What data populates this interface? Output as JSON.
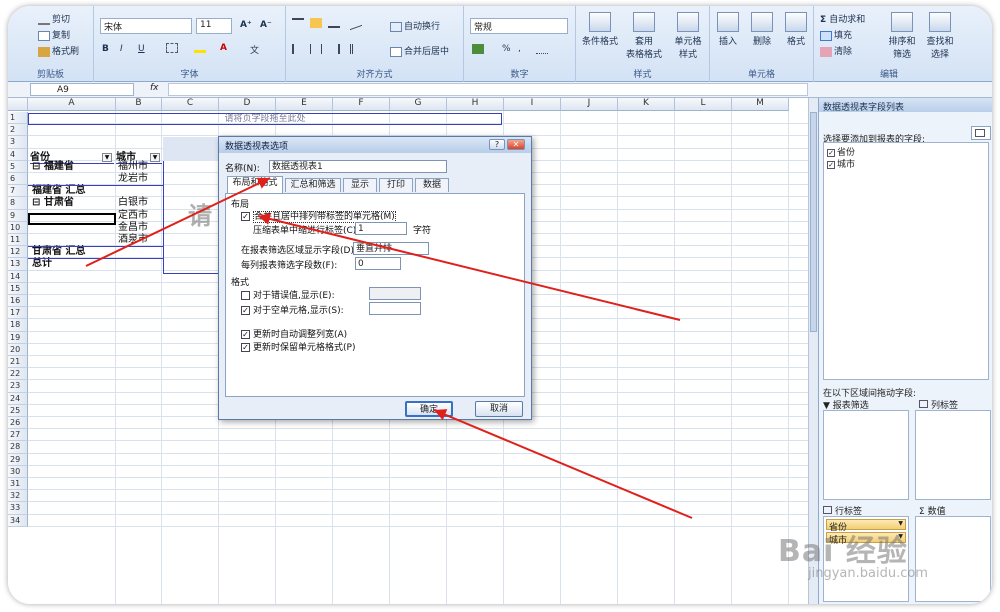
{
  "ribbon": {
    "clipboard": {
      "cut": "剪切",
      "copy": "复制",
      "format_painter": "格式刷",
      "label": "剪贴板"
    },
    "font": {
      "name": "宋体",
      "size": "11",
      "label": "字体",
      "bold": "B",
      "italic": "I",
      "underline": "U",
      "grow": "A⁺",
      "shrink": "A⁻",
      "phonetic": "文"
    },
    "alignment": {
      "wrap": "自动换行",
      "merge": "合并后居中",
      "label": "对齐方式"
    },
    "number": {
      "format": "常规",
      "percent": "%",
      "comma": ",",
      "label": "数字"
    },
    "styles": {
      "conditional": "条件格式",
      "table": "套用\n表格格式",
      "cell": "单元格\n样式",
      "label": "样式"
    },
    "cells": {
      "insert": "插入",
      "delete": "删除",
      "format": "格式",
      "label": "单元格"
    },
    "editing": {
      "autosum": "自动求和",
      "fill": "填充",
      "clear": "清除",
      "sort": "排序和\n筛选",
      "find": "查找和\n选择",
      "label": "编辑"
    }
  },
  "formula_bar": {
    "name_box": "A9",
    "fx": "fx",
    "content": ""
  },
  "sheet": {
    "columns": [
      "A",
      "B",
      "C",
      "D",
      "E",
      "F",
      "G",
      "H",
      "I",
      "J",
      "K",
      "L",
      "M"
    ],
    "rows": [
      "1",
      "2",
      "3",
      "4",
      "5",
      "6",
      "7",
      "8",
      "9",
      "10",
      "11",
      "12",
      "13",
      "14",
      "15",
      "16",
      "17",
      "18",
      "19",
      "20",
      "21",
      "22",
      "23",
      "24",
      "25",
      "26",
      "27",
      "28",
      "29",
      "30",
      "31",
      "32",
      "33",
      "34"
    ],
    "drop_page_fields": "请将页字段拖至此处",
    "drop_hint": "请",
    "header_province": "省份",
    "header_city": "城市",
    "pivot_rows": [
      {
        "province": "⊟ 福建省",
        "city": "福州市"
      },
      {
        "province": "",
        "city": "龙岩市"
      },
      {
        "province": "福建省 汇总",
        "city": ""
      },
      {
        "province": "⊟ 甘肃省",
        "city": "白银市"
      },
      {
        "province": "",
        "city": "定西市"
      },
      {
        "province": "",
        "city": "金昌市"
      },
      {
        "province": "",
        "city": "酒泉市"
      },
      {
        "province": "甘肃省 汇总",
        "city": ""
      },
      {
        "province": "总计",
        "city": ""
      }
    ]
  },
  "field_list": {
    "title": "数据透视表字段列表",
    "choose_label": "选择要添加到报表的字段:",
    "fields": [
      "省份",
      "城市"
    ],
    "drag_label": "在以下区域间拖动字段:",
    "report_filter": "报表筛选",
    "column_labels": "列标签",
    "row_labels": "行标签",
    "values": "数值",
    "row_items": [
      "省份",
      "城市"
    ],
    "sigma": "Σ"
  },
  "dialog": {
    "title": "数据透视表选项",
    "help": "?",
    "close": "✕",
    "name_label": "名称(N):",
    "name_value": "数据透视表1",
    "tabs": [
      "布局和格式",
      "汇总和筛选",
      "显示",
      "打印",
      "数据"
    ],
    "layout_section": "布局",
    "merge_center": "合并且居中排列带标签的单元格(M)",
    "compact_indent": "压缩表单中缩进行标签(C):",
    "indent_value": "1",
    "indent_unit": "字符",
    "filter_display": "在报表筛选区域显示字段(D):",
    "filter_display_value": "垂直并排",
    "fields_per_column": "每列报表筛选字段数(F):",
    "fields_per_column_value": "0",
    "format_section": "格式",
    "error_values": "对于错误值,显示(E):",
    "empty_cells": "对于空单元格,显示(S):",
    "autofit": "更新时自动调整列宽(A)",
    "preserve_format": "更新时保留单元格格式(P)",
    "ok": "确定",
    "cancel": "取消"
  },
  "watermark": {
    "main": "Bai 经验",
    "sub": "jingyan.baidu.com"
  },
  "colors": {
    "arrow": "#e0201a",
    "pivot_border": "#3a3fbf",
    "ribbon": "#d3e2f5",
    "active_cell": "#000000"
  }
}
